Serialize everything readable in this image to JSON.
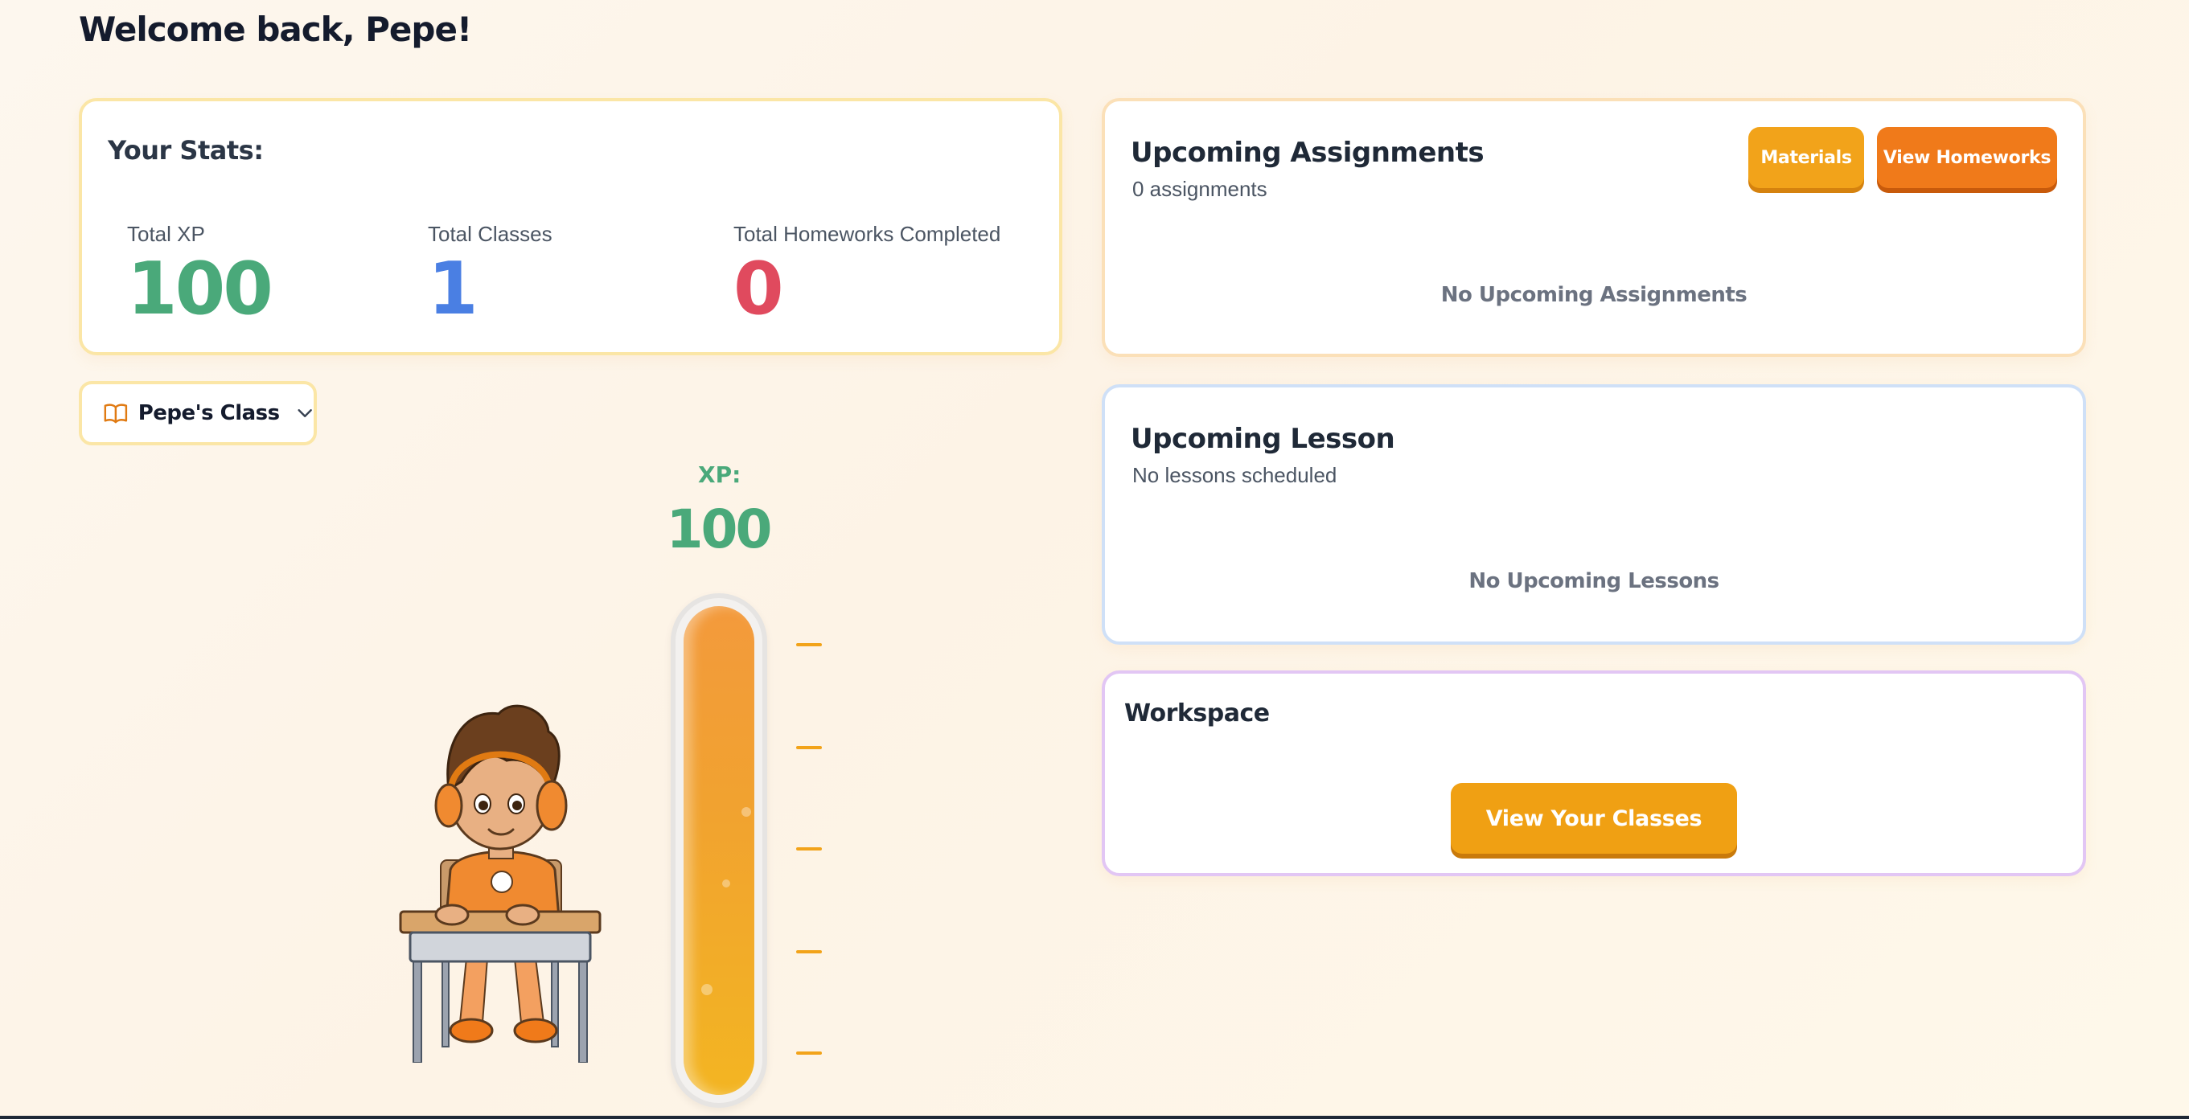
{
  "welcome": "Welcome back, Pepe!",
  "stats": {
    "title": "Your Stats:",
    "items": [
      {
        "label": "Total XP",
        "value": "100",
        "color": "#4aa97a"
      },
      {
        "label": "Total Classes",
        "value": "1",
        "color": "#4a7fe3"
      },
      {
        "label": "Total Homeworks Completed",
        "value": "0",
        "color": "#e04a5e"
      }
    ]
  },
  "class_selector": {
    "label": "Pepe's Class",
    "icon": "book-open-icon"
  },
  "xp_meter": {
    "label": "XP:",
    "value": "100",
    "fill_fraction": 1.0,
    "ticks": 5
  },
  "assignments": {
    "title": "Upcoming Assignments",
    "subtitle": "0 assignments",
    "empty": "No Upcoming Assignments",
    "materials_label": "Materials",
    "homework_label": "View Homeworks"
  },
  "lesson": {
    "title": "Upcoming Lesson",
    "subtitle": "No lessons scheduled",
    "empty": "No Upcoming Lessons"
  },
  "workspace": {
    "title": "Workspace",
    "button_label": "View Your Classes"
  },
  "colors": {
    "green": "#4aa97a",
    "blue": "#4a7fe3",
    "red": "#e04a5e",
    "orange": "#f07a1a",
    "amber": "#f2a31a"
  }
}
